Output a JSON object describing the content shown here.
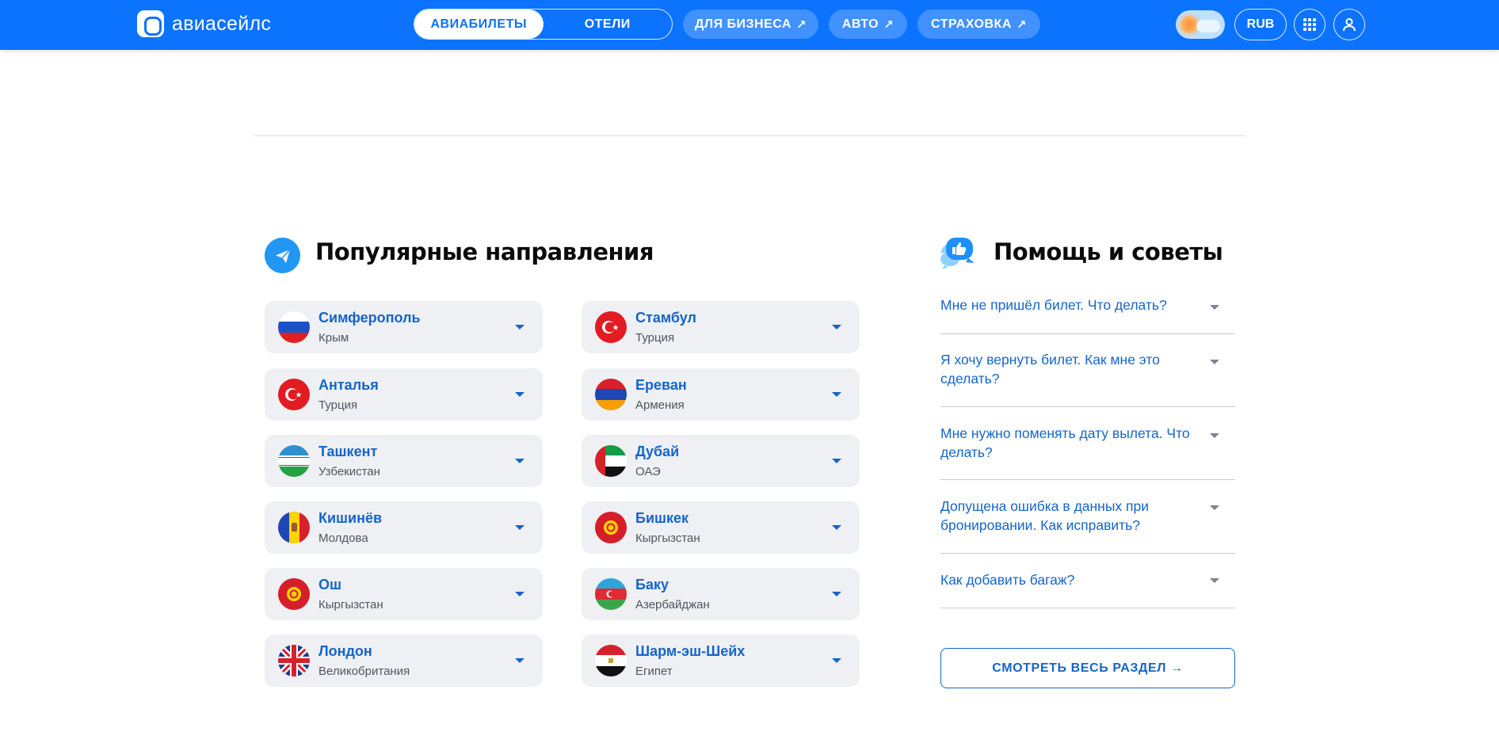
{
  "header": {
    "logo_text": "авиасейлс",
    "segments": [
      "АВИАБИЛЕТЫ",
      "ОТЕЛИ"
    ],
    "links": [
      {
        "label": "ДЛЯ БИЗНЕСА",
        "arrow": "↗"
      },
      {
        "label": "АВТО",
        "arrow": "↗"
      },
      {
        "label": "СТРАХОВКА",
        "arrow": "↗"
      }
    ],
    "currency": "RUB",
    "icons": [
      "theme-toggle-icon",
      "apps-grid-icon",
      "user-icon"
    ]
  },
  "popular": {
    "title": "Популярные направления",
    "icon": "paper-plane-icon",
    "destinations": [
      {
        "city": "Симферополь",
        "country": "Крым",
        "flag": "ru"
      },
      {
        "city": "Стамбул",
        "country": "Турция",
        "flag": "tr"
      },
      {
        "city": "Анталья",
        "country": "Турция",
        "flag": "tr"
      },
      {
        "city": "Ереван",
        "country": "Армения",
        "flag": "am"
      },
      {
        "city": "Ташкент",
        "country": "Узбекистан",
        "flag": "uz"
      },
      {
        "city": "Дубай",
        "country": "ОАЭ",
        "flag": "ae"
      },
      {
        "city": "Кишинёв",
        "country": "Молдова",
        "flag": "md"
      },
      {
        "city": "Бишкек",
        "country": "Кыргызстан",
        "flag": "kg"
      },
      {
        "city": "Ош",
        "country": "Кыргызстан",
        "flag": "kg"
      },
      {
        "city": "Баку",
        "country": "Азербайджан",
        "flag": "az"
      },
      {
        "city": "Лондон",
        "country": "Великобритания",
        "flag": "gb"
      },
      {
        "city": "Шарм-эш-Шейх",
        "country": "Египет",
        "flag": "eg"
      }
    ]
  },
  "help": {
    "title": "Помощь и советы",
    "icon": "thumbs-up-chat-icon",
    "questions": [
      "Мне не пришёл билет. Что делать?",
      "Я хочу вернуть билет. Как мне это сделать?",
      "Мне нужно поменять дату вылета. Что делать?",
      "Допущена ошибка в данных при бронировании. Как исправить?",
      "Как добавить багаж?"
    ],
    "all_button": "СМОТРЕТЬ ВЕСЬ РАЗДЕЛ →"
  },
  "colors": {
    "brand": "#0c73fe",
    "link": "#1565c8",
    "card_bg": "#eef0f3"
  }
}
